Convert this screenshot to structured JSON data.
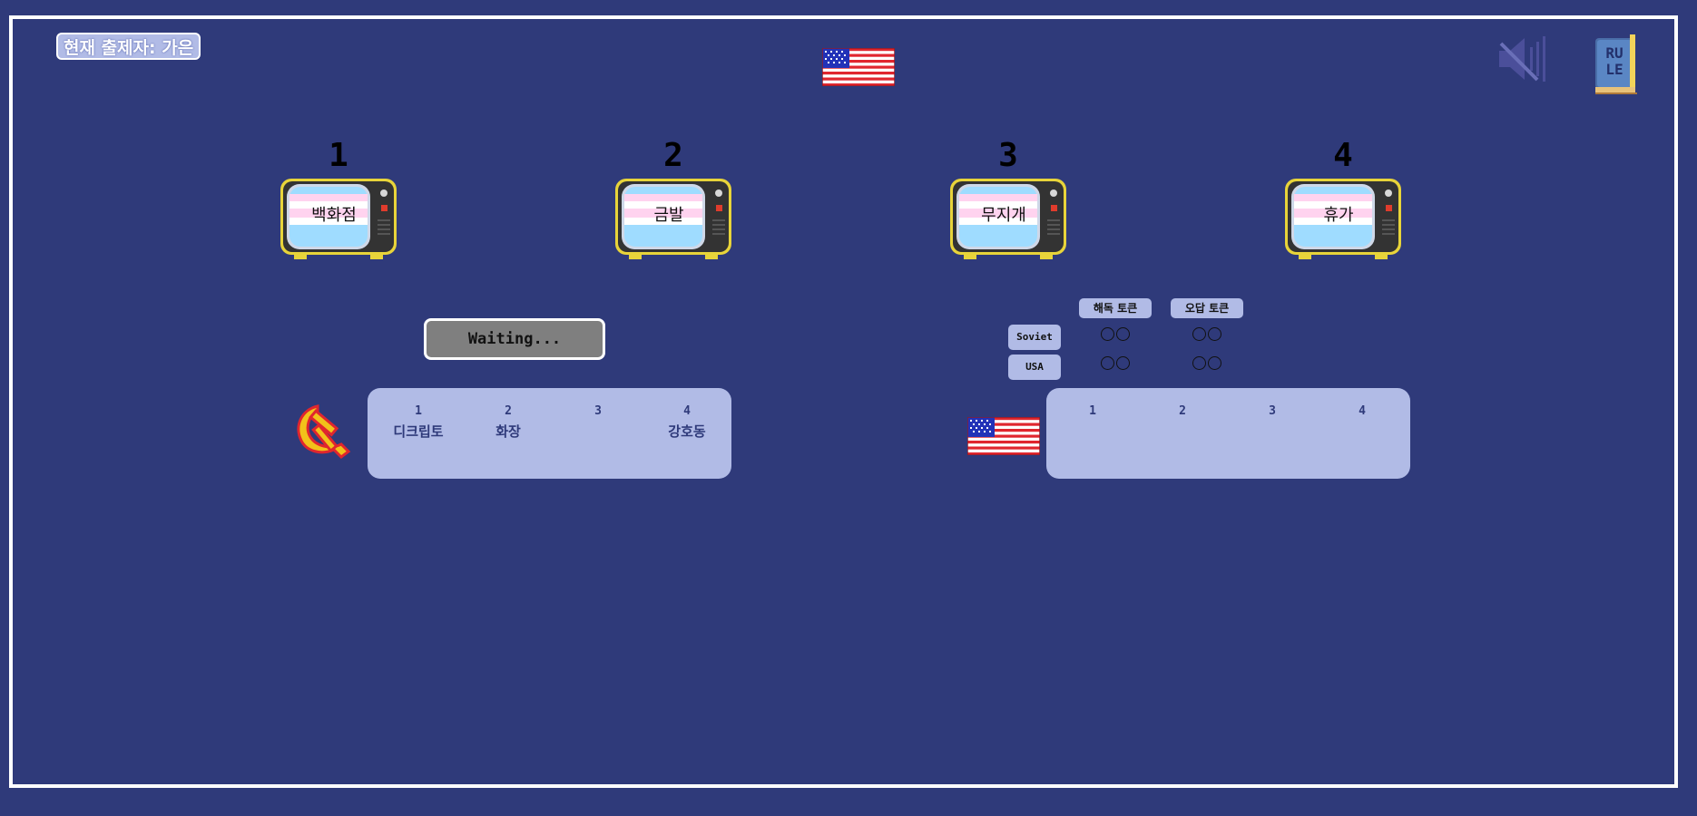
{
  "presenter_label": "현재 출제자: 가은",
  "current_team_flag": "usa-flag-icon",
  "controls": {
    "mute_icon": "speaker-muted-icon",
    "rule_icon": "rule-book-icon",
    "rule_text_line1": "RU",
    "rule_text_line2": "LE"
  },
  "keywords": [
    {
      "number": "1",
      "word": "백화점"
    },
    {
      "number": "2",
      "word": "금발"
    },
    {
      "number": "3",
      "word": "무지개"
    },
    {
      "number": "4",
      "word": "휴가"
    }
  ],
  "status_button": "Waiting...",
  "tokens": {
    "decode_label": "해독 토큰",
    "wrong_label": "오답 토큰",
    "teams": [
      {
        "name": "Soviet",
        "decode": 2,
        "wrong": 2
      },
      {
        "name": "USA",
        "decode": 2,
        "wrong": 2
      }
    ]
  },
  "soviet_panel": {
    "icon": "hammer-sickle-icon",
    "columns": [
      {
        "number": "1",
        "word": "디크립토"
      },
      {
        "number": "2",
        "word": "화장"
      },
      {
        "number": "3",
        "word": ""
      },
      {
        "number": "4",
        "word": "강호동"
      }
    ]
  },
  "usa_panel": {
    "icon": "usa-flag-icon",
    "columns": [
      {
        "number": "1",
        "word": ""
      },
      {
        "number": "2",
        "word": ""
      },
      {
        "number": "3",
        "word": ""
      },
      {
        "number": "4",
        "word": ""
      }
    ]
  },
  "colors": {
    "background": "#2f3a7a",
    "panel": "#b1bbe6",
    "tv_frame": "#e8d43a",
    "tv_body": "#333333",
    "screen_pink": "#ffd3ef",
    "screen_blue": "#9fdcff"
  }
}
